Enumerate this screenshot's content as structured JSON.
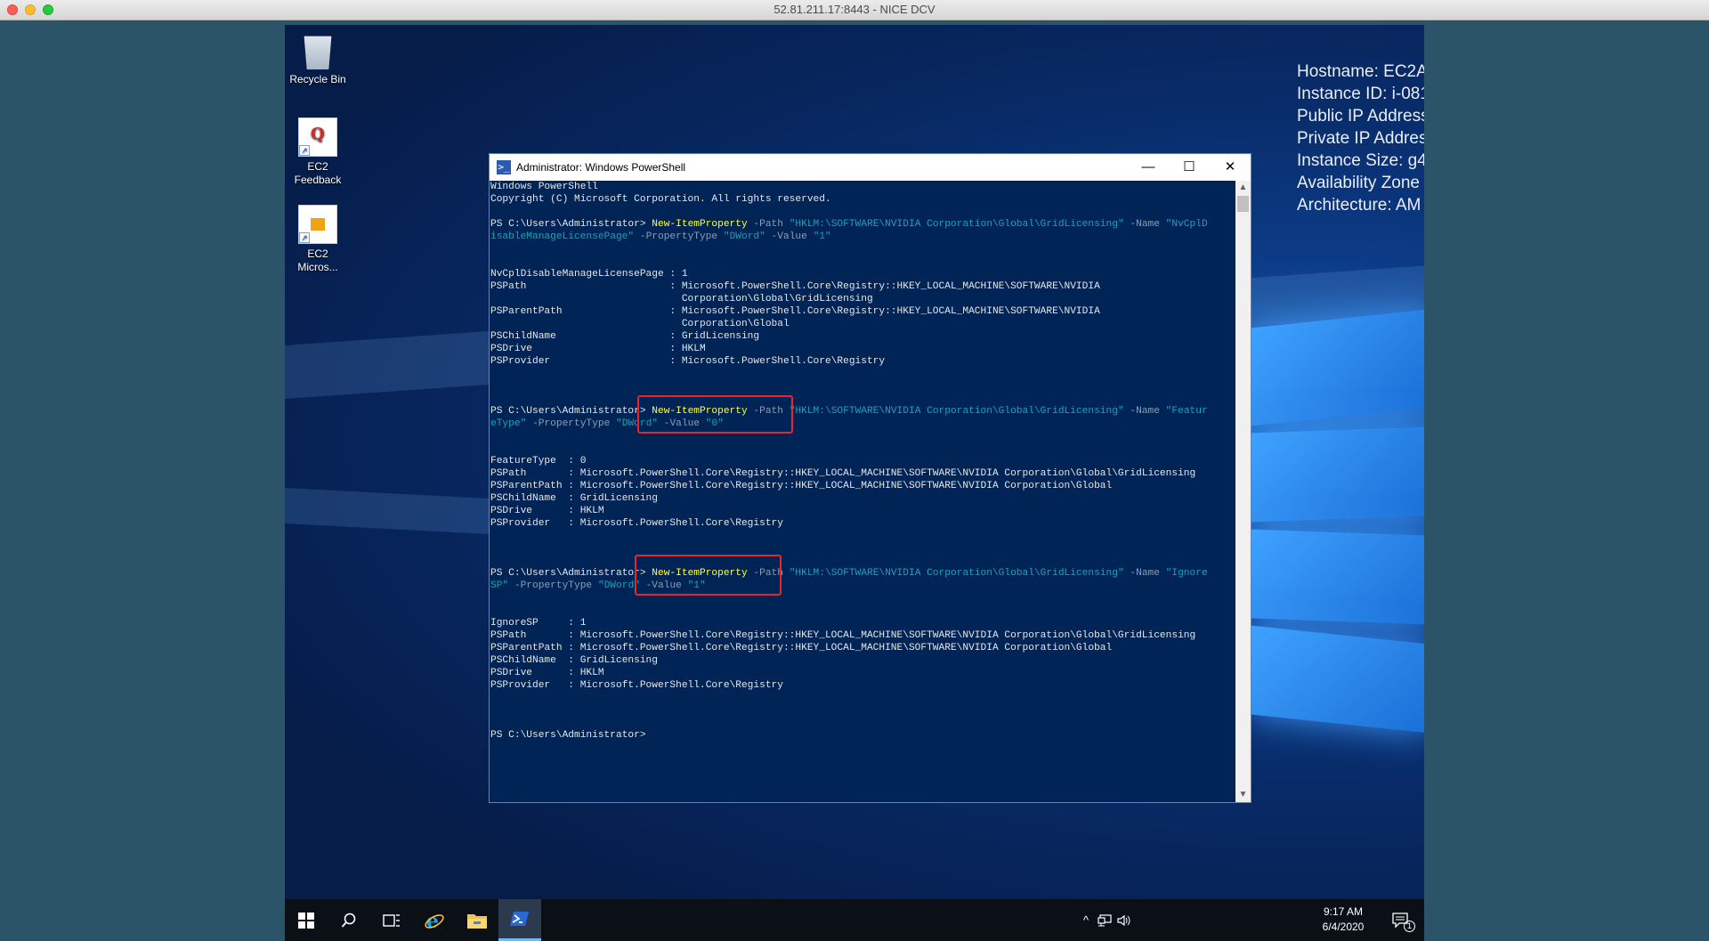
{
  "mac_window": {
    "title": "52.81.211.17:8443 - NICE DCV"
  },
  "sysinfo": [
    "Hostname: EC2A",
    "Instance ID: i-081",
    "Public IP Address",
    "Private IP Addres",
    "Instance Size: g4",
    "Availability Zone",
    "Architecture: AM"
  ],
  "desktop_icons": {
    "recycle": "Recycle Bin",
    "feedback_1": "EC2",
    "feedback_2": "Feedback",
    "micros_1": "EC2",
    "micros_2": "Micros..."
  },
  "powershell": {
    "title": "Administrator: Windows PowerShell",
    "minimize": "—",
    "maximize": "☐",
    "close": "✕",
    "lines": [
      [
        {
          "t": "Windows PowerShell"
        }
      ],
      [
        {
          "t": "Copyright (C) Microsoft Corporation. All rights reserved."
        }
      ],
      [
        {
          "t": ""
        }
      ],
      [
        {
          "t": "PS C:\\Users\\Administrator> "
        },
        {
          "t": "New-ItemProperty",
          "c": "cmd"
        },
        {
          "t": " -Path ",
          "c": "par"
        },
        {
          "t": "\"HKLM:\\SOFTWARE\\NVIDIA Corporation\\Global\\GridLicensing\"",
          "c": "str"
        },
        {
          "t": " -Name ",
          "c": "par"
        },
        {
          "t": "\"NvCplD",
          "c": "str"
        }
      ],
      [
        {
          "t": "isableManageLicensePage\"",
          "c": "str"
        },
        {
          "t": " -PropertyType ",
          "c": "par"
        },
        {
          "t": "\"DWord\"",
          "c": "str"
        },
        {
          "t": " -Value ",
          "c": "par"
        },
        {
          "t": "\"1\"",
          "c": "str"
        }
      ],
      [
        {
          "t": ""
        }
      ],
      [
        {
          "t": ""
        }
      ],
      [
        {
          "t": "NvCplDisableManageLicensePage : 1"
        }
      ],
      [
        {
          "t": "PSPath                        : Microsoft.PowerShell.Core\\Registry::HKEY_LOCAL_MACHINE\\SOFTWARE\\NVIDIA"
        }
      ],
      [
        {
          "t": "                                Corporation\\Global\\GridLicensing"
        }
      ],
      [
        {
          "t": "PSParentPath                  : Microsoft.PowerShell.Core\\Registry::HKEY_LOCAL_MACHINE\\SOFTWARE\\NVIDIA"
        }
      ],
      [
        {
          "t": "                                Corporation\\Global"
        }
      ],
      [
        {
          "t": "PSChildName                   : GridLicensing"
        }
      ],
      [
        {
          "t": "PSDrive                       : HKLM"
        }
      ],
      [
        {
          "t": "PSProvider                    : Microsoft.PowerShell.Core\\Registry"
        }
      ],
      [
        {
          "t": ""
        }
      ],
      [
        {
          "t": ""
        }
      ],
      [
        {
          "t": ""
        }
      ],
      [
        {
          "t": "PS C:\\Users\\Administrator> "
        },
        {
          "t": "New-ItemProperty",
          "c": "cmd"
        },
        {
          "t": " -Path ",
          "c": "par"
        },
        {
          "t": "\"HKLM:\\SOFTWARE\\NVIDIA Corporation\\Global\\GridLicensing\"",
          "c": "str"
        },
        {
          "t": " -Name ",
          "c": "par"
        },
        {
          "t": "\"Featur",
          "c": "str"
        }
      ],
      [
        {
          "t": "eType\"",
          "c": "str"
        },
        {
          "t": " -PropertyType ",
          "c": "par"
        },
        {
          "t": "\"DWord\"",
          "c": "str"
        },
        {
          "t": " -Value ",
          "c": "par"
        },
        {
          "t": "\"0\"",
          "c": "str"
        }
      ],
      [
        {
          "t": ""
        }
      ],
      [
        {
          "t": ""
        }
      ],
      [
        {
          "t": "FeatureType  : 0"
        }
      ],
      [
        {
          "t": "PSPath       : Microsoft.PowerShell.Core\\Registry::HKEY_LOCAL_MACHINE\\SOFTWARE\\NVIDIA Corporation\\Global\\GridLicensing"
        }
      ],
      [
        {
          "t": "PSParentPath : Microsoft.PowerShell.Core\\Registry::HKEY_LOCAL_MACHINE\\SOFTWARE\\NVIDIA Corporation\\Global"
        }
      ],
      [
        {
          "t": "PSChildName  : GridLicensing"
        }
      ],
      [
        {
          "t": "PSDrive      : HKLM"
        }
      ],
      [
        {
          "t": "PSProvider   : Microsoft.PowerShell.Core\\Registry"
        }
      ],
      [
        {
          "t": ""
        }
      ],
      [
        {
          "t": ""
        }
      ],
      [
        {
          "t": ""
        }
      ],
      [
        {
          "t": "PS C:\\Users\\Administrator> "
        },
        {
          "t": "New-ItemProperty",
          "c": "cmd"
        },
        {
          "t": " -Path ",
          "c": "par"
        },
        {
          "t": "\"HKLM:\\SOFTWARE\\NVIDIA Corporation\\Global\\GridLicensing\"",
          "c": "str"
        },
        {
          "t": " -Name ",
          "c": "par"
        },
        {
          "t": "\"Ignore",
          "c": "str"
        }
      ],
      [
        {
          "t": "SP\"",
          "c": "str"
        },
        {
          "t": " -PropertyType ",
          "c": "par"
        },
        {
          "t": "\"DWord\"",
          "c": "str"
        },
        {
          "t": " -Value ",
          "c": "par"
        },
        {
          "t": "\"1\"",
          "c": "str"
        }
      ],
      [
        {
          "t": ""
        }
      ],
      [
        {
          "t": ""
        }
      ],
      [
        {
          "t": "IgnoreSP     : 1"
        }
      ],
      [
        {
          "t": "PSPath       : Microsoft.PowerShell.Core\\Registry::HKEY_LOCAL_MACHINE\\SOFTWARE\\NVIDIA Corporation\\Global\\GridLicensing"
        }
      ],
      [
        {
          "t": "PSParentPath : Microsoft.PowerShell.Core\\Registry::HKEY_LOCAL_MACHINE\\SOFTWARE\\NVIDIA Corporation\\Global"
        }
      ],
      [
        {
          "t": "PSChildName  : GridLicensing"
        }
      ],
      [
        {
          "t": "PSDrive      : HKLM"
        }
      ],
      [
        {
          "t": "PSProvider   : Microsoft.PowerShell.Core\\Registry"
        }
      ],
      [
        {
          "t": ""
        }
      ],
      [
        {
          "t": ""
        }
      ],
      [
        {
          "t": ""
        }
      ],
      [
        {
          "t": "PS C:\\Users\\Administrator>"
        }
      ]
    ]
  },
  "taskbar": {
    "start_icon": "windows-logo-icon",
    "search_icon": "search-icon",
    "taskview_icon": "task-view-icon",
    "ie_icon": "internet-explorer-icon",
    "explorer_icon": "file-explorer-icon",
    "powershell_icon": "powershell-icon",
    "tray_chevron": "^",
    "time": "9:17 AM",
    "date": "6/4/2020",
    "notification_count": "1"
  },
  "colors": {
    "command": "#ffff3a",
    "parameter": "#8c9db5",
    "string": "#1aa3b5",
    "console_bg": "#012456",
    "highlight_box": "#e8252f"
  }
}
